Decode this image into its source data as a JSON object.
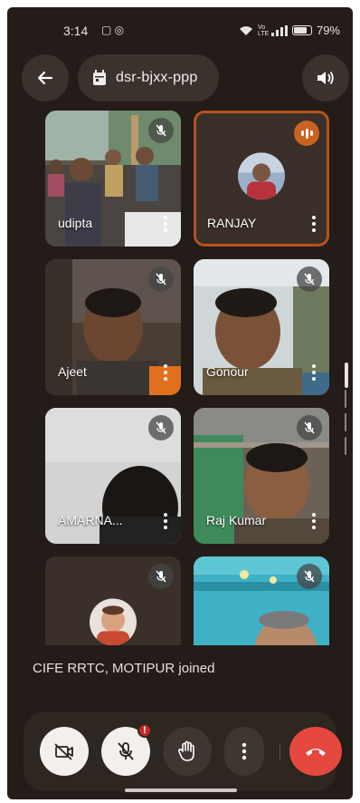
{
  "status": {
    "time": "3:14",
    "left_icons": "▢ ◎",
    "battery": "79%",
    "network": "Vo LTE"
  },
  "header": {
    "meeting_code": "dsr-bjxx-ppp",
    "back_icon": "arrow-left-icon",
    "speaker_icon": "speaker-icon",
    "calendar_icon": "calendar-icon"
  },
  "participants": [
    {
      "name": "udipta",
      "muted": true
    },
    {
      "name": "RANJAY",
      "muted": false,
      "speaking": true
    },
    {
      "name": "Ajeet",
      "muted": true
    },
    {
      "name": "Gonour",
      "muted": true
    },
    {
      "name": "AMARNA...",
      "muted": true
    },
    {
      "name": "Raj Kumar",
      "muted": true
    },
    {
      "name": "",
      "muted": true
    },
    {
      "name": "",
      "muted": true
    }
  ],
  "toast": "CIFE RRTC, MOTIPUR joined",
  "controls": {
    "camera": "camera-off-icon",
    "mic": "mic-off-icon",
    "mic_badge": "!",
    "hand": "raise-hand-icon",
    "more": "more-vert-icon",
    "end": "end-call-icon"
  },
  "colors": {
    "background": "#231c18",
    "speaking_border": "#b5531c",
    "end_call": "#e5483e"
  }
}
